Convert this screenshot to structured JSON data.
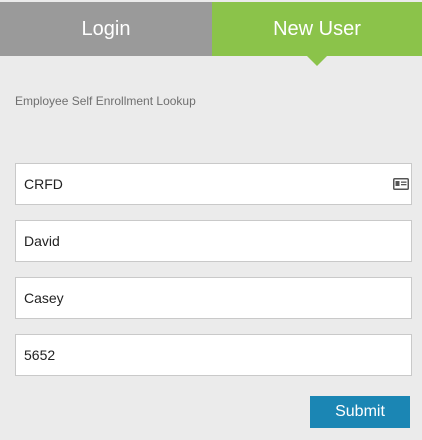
{
  "tabs": {
    "login": "Login",
    "new_user": "New User"
  },
  "form": {
    "subtitle": "Employee Self Enrollment Lookup",
    "fields": [
      {
        "value": "CRFD",
        "icon": "id-card-icon"
      },
      {
        "value": "David"
      },
      {
        "value": "Casey"
      },
      {
        "value": "5652"
      }
    ],
    "submit_label": "Submit"
  },
  "colors": {
    "tab_inactive": "#9a9a9a",
    "tab_active": "#8bc34a",
    "submit": "#1b86b4",
    "background": "#ebebeb"
  }
}
